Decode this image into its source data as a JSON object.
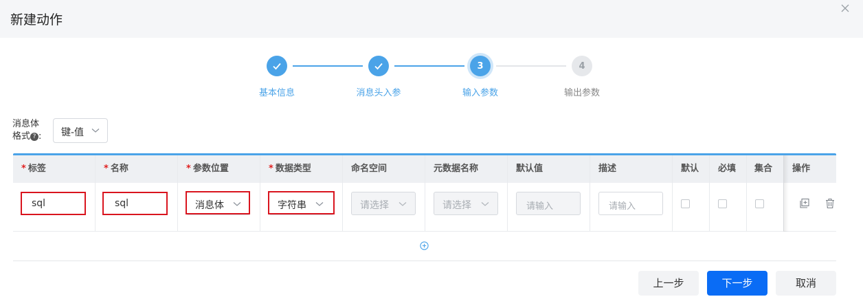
{
  "dialog": {
    "title": "新建动作"
  },
  "steps": [
    {
      "label": "基本信息",
      "number": "1",
      "state": "done"
    },
    {
      "label": "消息头入参",
      "number": "2",
      "state": "done"
    },
    {
      "label": "输入参数",
      "number": "3",
      "state": "active"
    },
    {
      "label": "输出参数",
      "number": "4",
      "state": "todo"
    }
  ],
  "format": {
    "label_line1": "消息体",
    "label_line2": "格式",
    "help": "?",
    "colon": ":",
    "value": "键-值"
  },
  "table": {
    "required_mark": "*",
    "headers": [
      "标签",
      "名称",
      "参数位置",
      "数据类型",
      "命名空间",
      "元数据名称",
      "默认值",
      "描述",
      "默认",
      "必填",
      "集合",
      "操作"
    ],
    "row": {
      "label": "sql",
      "name": "sql",
      "position": "消息体",
      "data_type": "字符串",
      "namespace_placeholder": "请选择",
      "metadata_placeholder": "请选择",
      "default_placeholder": "请输入",
      "desc_placeholder": "请输入",
      "is_default": false,
      "is_required": false,
      "is_collection": false
    }
  },
  "footer": {
    "prev": "上一步",
    "next": "下一步",
    "cancel": "取消"
  },
  "colors": {
    "primary": "#0a6cf5",
    "step": "#4aa3e8",
    "highlight": "#d9141e"
  }
}
